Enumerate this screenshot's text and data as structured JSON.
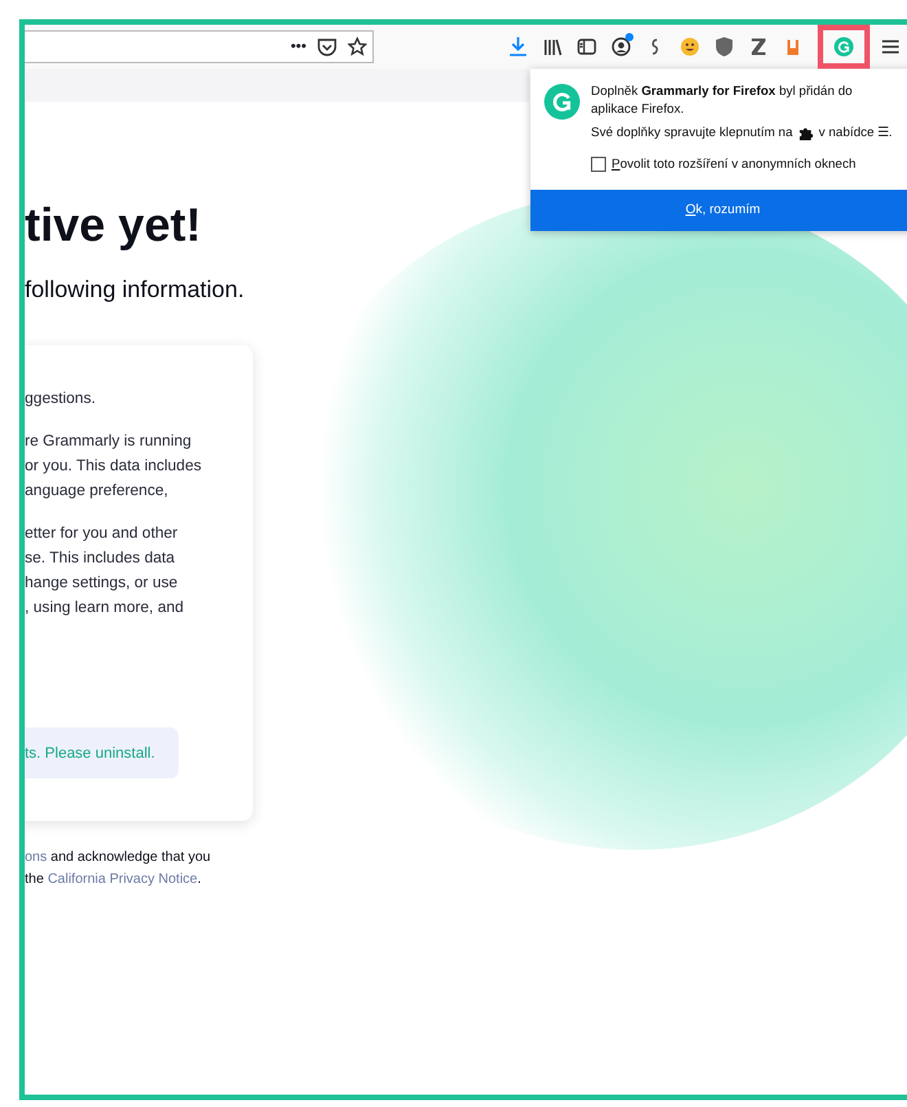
{
  "toolbar": {
    "icons": [
      {
        "kind": "download"
      },
      {
        "kind": "library"
      },
      {
        "kind": "sidebar"
      },
      {
        "kind": "account",
        "badge": true
      },
      {
        "kind": "script"
      },
      {
        "kind": "smiley"
      },
      {
        "kind": "shield"
      },
      {
        "kind": "zletter"
      },
      {
        "kind": "orange"
      },
      {
        "kind": "grammarly",
        "highlighted": true
      },
      {
        "kind": "menu"
      }
    ]
  },
  "address_bar": {
    "actions": [
      "•••"
    ]
  },
  "popup": {
    "message_before": "Doplněk ",
    "message_bold": "**Grammarly for Firefox**",
    "message_after": " byl přidán do aplikace Firefox.",
    "hint_before": "Své doplňky spravujte klepnutím na",
    "hint_after": "v nabídce ☰.",
    "checkbox": {
      "label": "Povolit toto rozšíření v anonymních oknech",
      "checked": false,
      "accesskey_underlined": true
    },
    "button": {
      "label": "Ok, rozumím",
      "accesskey_underlined": true
    }
  },
  "page": {
    "heading": "tive yet!",
    "subheading": "following information.",
    "card": {
      "paragraphs": [
        [
          "ggestions."
        ],
        [
          "re Grammarly is running",
          "or you. This data includes",
          "anguage preference,"
        ],
        [
          "etter for you and other",
          "se. This includes data",
          "hange settings, or use",
          ", using learn more, and"
        ]
      ],
      "notice": "ts. Please uninstall."
    },
    "footer": [
      {
        "link": "ons",
        "text": " and acknowledge that you"
      },
      {
        "text": "the ",
        "link_after": "California Privacy Notice",
        "tail": "."
      }
    ]
  }
}
